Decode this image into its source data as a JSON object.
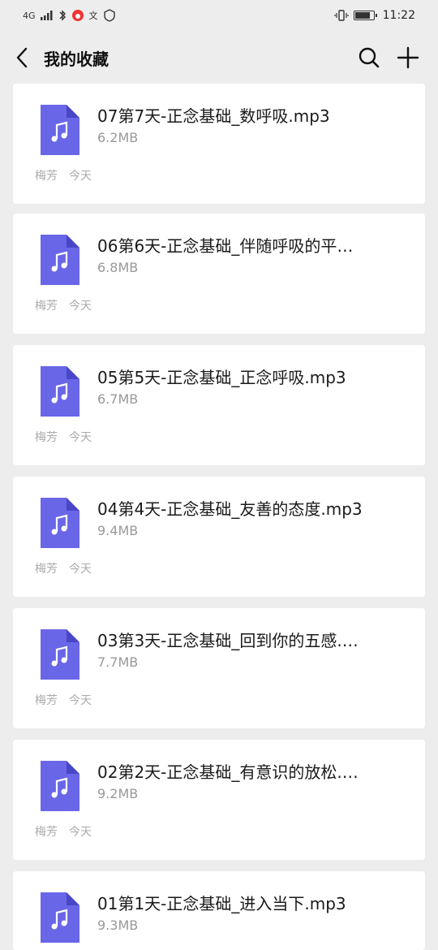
{
  "status_bar": {
    "network": "4G",
    "time": "11:22",
    "app_icon_char": "文"
  },
  "navbar": {
    "title": "我的收藏",
    "back_icon": "chevron-left-icon",
    "search_icon": "search-icon",
    "add_icon": "plus-icon"
  },
  "accent": "#6a66e8",
  "items": [
    {
      "name": "07第7天-正念基础_数呼吸.mp3",
      "size": "6.2MB",
      "source": "梅芳",
      "date": "今天"
    },
    {
      "name": "06第6天-正念基础_伴随呼吸的平…",
      "size": "6.8MB",
      "source": "梅芳",
      "date": "今天"
    },
    {
      "name": "05第5天-正念基础_正念呼吸.mp3",
      "size": "6.7MB",
      "source": "梅芳",
      "date": "今天"
    },
    {
      "name": "04第4天-正念基础_友善的态度.mp3",
      "size": "9.4MB",
      "source": "梅芳",
      "date": "今天"
    },
    {
      "name": "03第3天-正念基础_回到你的五感.…",
      "size": "7.7MB",
      "source": "梅芳",
      "date": "今天"
    },
    {
      "name": "02第2天-正念基础_有意识的放松.…",
      "size": "9.2MB",
      "source": "梅芳",
      "date": "今天"
    },
    {
      "name": "01第1天-正念基础_进入当下.mp3",
      "size": "9.3MB",
      "source": "",
      "date": ""
    }
  ]
}
